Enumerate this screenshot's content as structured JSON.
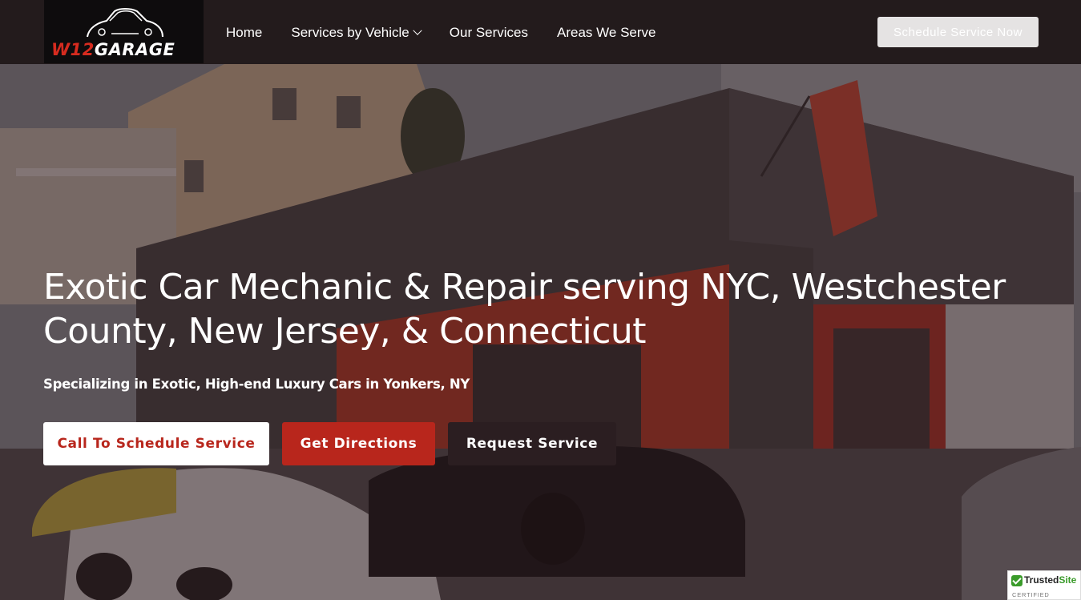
{
  "logo": {
    "text_prefix": "W12",
    "text_suffix": "GARAGE"
  },
  "nav": {
    "items": [
      {
        "label": "Home"
      },
      {
        "label": "Services by Vehicle",
        "has_dropdown": true
      },
      {
        "label": "Our Services"
      },
      {
        "label": "Areas We Serve"
      }
    ],
    "cta_label": "Schedule Service Now"
  },
  "hero": {
    "title": "Exotic Car Mechanic & Repair serving NYC, Westchester County, New Jersey, & Connecticut",
    "subtitle": "Specializing in Exotic, High-end Luxury Cars in Yonkers, NY",
    "buttons": {
      "call": "Call To Schedule Service",
      "directions": "Get Directions",
      "request": "Request Service"
    }
  },
  "badge": {
    "brand_prefix": "Trusted",
    "brand_suffix": "Site",
    "tagline": "CERTIFIED SECURE"
  },
  "colors": {
    "accent_red": "#b8261c",
    "header_bg": "#231b1c",
    "dark_button": "#2b1e21"
  }
}
